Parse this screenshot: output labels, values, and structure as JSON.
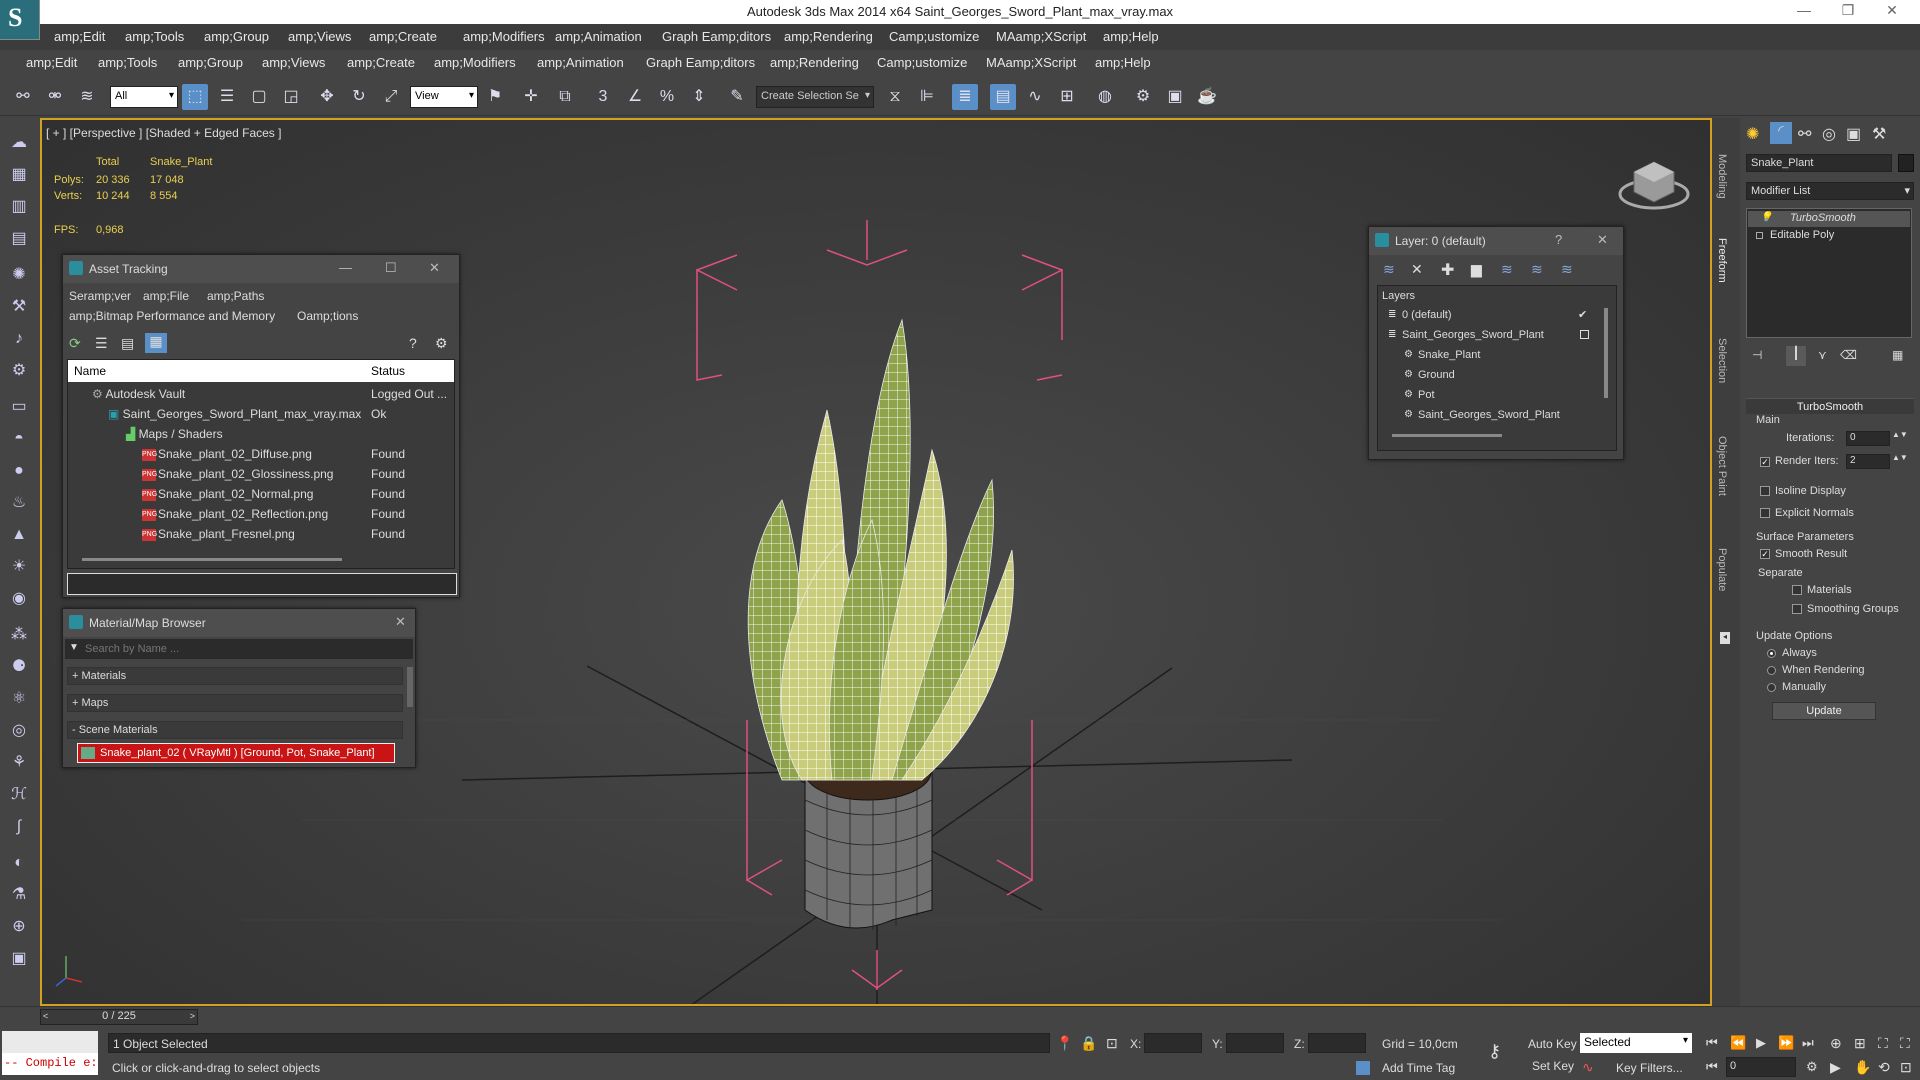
{
  "window": {
    "title": "Autodesk 3ds Max  2014 x64     Saint_Georges_Sword_Plant_max_vray.max"
  },
  "menu1": [
    "amp;Edit",
    "amp;Tools",
    "amp;Group",
    "amp;Views",
    "amp;Create",
    "amp;Modifiers",
    "amp;Animation",
    "Graph Eamp;ditors",
    "amp;Rendering",
    "Camp;ustomize",
    "MAamp;XScript",
    "amp;Help"
  ],
  "menu2": [
    "amp;Edit",
    "amp;Tools",
    "amp;Group",
    "amp;Views",
    "amp;Create",
    "amp;Modifiers",
    "amp;Animation",
    "Graph Eamp;ditors",
    "amp;Rendering",
    "Camp;ustomize",
    "MAamp;XScript",
    "amp;Help"
  ],
  "toolbar": {
    "filter_value": "All",
    "view_value": "View",
    "selection_set_placeholder": "Create Selection Se",
    "snap_label": "3"
  },
  "viewport": {
    "label": "[ + ] [Perspective ] [Shaded + Edged Faces ]",
    "stats": {
      "col_total": "Total",
      "col_object": "Snake_Plant",
      "polys_label": "Polys:",
      "polys_total": "20 336",
      "polys_object": "17 048",
      "verts_label": "Verts:",
      "verts_total": "10 244",
      "verts_object": "8 554",
      "fps_label": "FPS:",
      "fps_value": "0,968"
    }
  },
  "asset_tracking": {
    "title": "Asset Tracking",
    "menu": [
      "Seramp;ver",
      "amp;File",
      "amp;Paths"
    ],
    "menu2": [
      "amp;Bitmap Performance and Memory",
      "Oamp;tions"
    ],
    "col_name": "Name",
    "col_status": "Status",
    "rows": [
      {
        "name": "Autodesk Vault",
        "status": "Logged Out ..."
      },
      {
        "name": "Saint_Georges_Sword_Plant_max_vray.max",
        "status": "Ok"
      },
      {
        "name": "Maps / Shaders",
        "status": ""
      },
      {
        "name": "Snake_plant_02_Diffuse.png",
        "status": "Found"
      },
      {
        "name": "Snake_plant_02_Glossiness.png",
        "status": "Found"
      },
      {
        "name": "Snake_plant_02_Normal.png",
        "status": "Found"
      },
      {
        "name": "Snake_plant_02_Reflection.png",
        "status": "Found"
      },
      {
        "name": "Snake_plant_Fresnel.png",
        "status": "Found"
      }
    ]
  },
  "material_browser": {
    "title": "Material/Map Browser",
    "search_placeholder": "Search by Name ...",
    "groups": [
      "+ Materials",
      "+ Maps",
      "- Scene Materials"
    ],
    "scene_material": "Snake_plant_02  ( VRayMtl )  [Ground, Pot, Snake_Plant]"
  },
  "layer_window": {
    "title": "Layer: 0 (default)",
    "help": "?",
    "header": "Layers",
    "items": [
      "0 (default)",
      "Saint_Georges_Sword_Plant",
      "Snake_Plant",
      "Ground",
      "Pot",
      "Saint_Georges_Sword_Plant"
    ]
  },
  "cmd_panel": {
    "object_name": "Snake_Plant",
    "modifier_list": "Modifier List",
    "stack": [
      "TurboSmooth",
      "Editable Poly"
    ],
    "turbosmooth_title": "TurboSmooth",
    "main_label": "Main",
    "iterations_label": "Iterations:",
    "iterations_value": "0",
    "render_iters_label": "Render Iters:",
    "render_iters_value": "2",
    "isoline_label": "Isoline Display",
    "explicit_normals_label": "Explicit Normals",
    "surface_params_label": "Surface Parameters",
    "smooth_result_label": "Smooth Result",
    "separate_label": "Separate",
    "materials_label": "Materials",
    "smoothing_groups_label": "Smoothing Groups",
    "update_options_label": "Update Options",
    "always_label": "Always",
    "when_rendering_label": "When Rendering",
    "manually_label": "Manually",
    "update_button": "Update"
  },
  "side_tabs": [
    "Modeling",
    "Freeform",
    "Selection",
    "Object Paint",
    "Populate"
  ],
  "bottom": {
    "timeline": "0 / 225",
    "script_listener": "-- Compile e:",
    "selection_status": "1 Object Selected",
    "prompt": "Click or click-and-drag to select objects",
    "x_label": "X:",
    "y_label": "Y:",
    "z_label": "Z:",
    "grid": "Grid = 10,0cm",
    "add_time_tag": "Add Time Tag",
    "auto_key": "Auto Key",
    "set_key": "Set Key",
    "selected_value": "Selected",
    "key_filters": "Key Filters...",
    "frame_value": "0"
  },
  "colors": {
    "viewport_border": "#d4a020",
    "stats_text": "#e8d050",
    "active_button": "#5b8fc7",
    "material_highlight": "#c81414"
  }
}
